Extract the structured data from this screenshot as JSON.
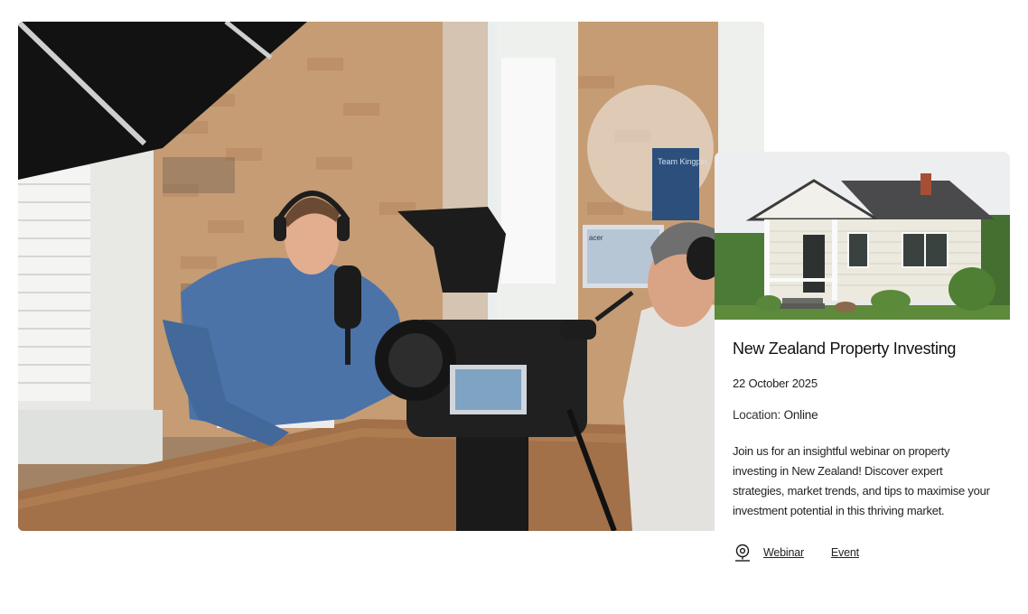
{
  "hero": {
    "image_alt": "Podcast recording studio with two hosts wearing headphones and a camera in the foreground",
    "poster_text": "Team Kingpin",
    "monitor_brand": "acer"
  },
  "event": {
    "title": "New Zealand Property Investing",
    "date": "22 October 2025",
    "location_label": "Location:",
    "location_value": "Online",
    "description": "Join us for an insightful webinar on property investing in New Zealand! Discover expert strategies, market trends, and tips to maximise your investment potential in this thriving market.",
    "tags": [
      "Webinar",
      "Event"
    ],
    "tag_icon": "location-pin-icon"
  }
}
